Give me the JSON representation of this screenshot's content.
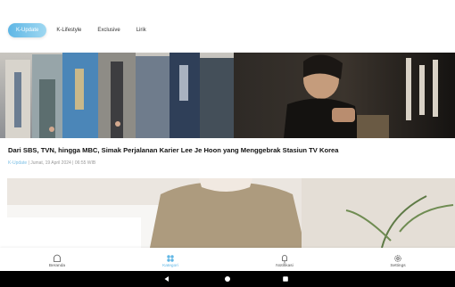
{
  "tabs": [
    {
      "label": "K-Update",
      "active": true
    },
    {
      "label": "K-Lifestyle",
      "active": false
    },
    {
      "label": "Exclusive",
      "active": false
    },
    {
      "label": "Lirik",
      "active": false
    }
  ],
  "article": {
    "title": "Dari SBS, TVN, hingga MBC, Simak Perjalanan Karier Lee Je Hoon yang Menggebrak Stasiun TV Korea",
    "category": "K-Update",
    "meta": " | Jumat, 19 April 2024 | 06:55 WIB"
  },
  "bottom_nav": [
    {
      "label": "Beranda",
      "icon": "home-icon",
      "active": false
    },
    {
      "label": "Kategori",
      "icon": "grid-icon",
      "active": true
    },
    {
      "label": "Notifikasi",
      "icon": "bell-icon",
      "active": false
    },
    {
      "label": "Settings",
      "icon": "gear-icon",
      "active": false
    }
  ],
  "colors": {
    "accent": "#5fb6e5",
    "title": "#111111",
    "meta": "#999999"
  },
  "system_nav": [
    "back-icon",
    "home-circle-icon",
    "recents-icon"
  ]
}
